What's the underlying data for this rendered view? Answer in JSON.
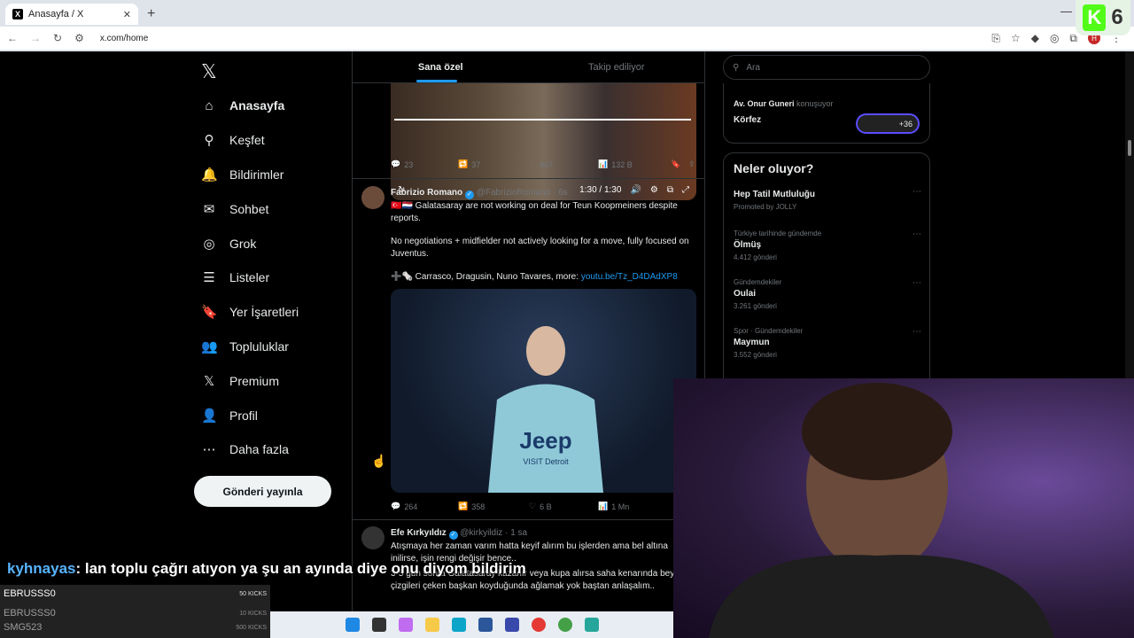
{
  "browser": {
    "tab_title": "Anasayfa / X",
    "tab_close": "✕",
    "new_tab": "+",
    "url": "x.com/home",
    "profile_initial": "H",
    "overlay_number": "6",
    "overlay_letter": "K"
  },
  "sidebar": {
    "logo": "𝕏",
    "items": [
      {
        "label": "Anasayfa",
        "icon": "home-icon",
        "glyph": "⌂"
      },
      {
        "label": "Keşfet",
        "icon": "search-icon",
        "glyph": "⚲"
      },
      {
        "label": "Bildirimler",
        "icon": "bell-icon",
        "glyph": "🔔"
      },
      {
        "label": "Sohbet",
        "icon": "mail-icon",
        "glyph": "✉"
      },
      {
        "label": "Grok",
        "icon": "grok-icon",
        "glyph": "◎"
      },
      {
        "label": "Listeler",
        "icon": "list-icon",
        "glyph": "☰"
      },
      {
        "label": "Yer İşaretleri",
        "icon": "bookmark-icon",
        "glyph": "🔖"
      },
      {
        "label": "Topluluklar",
        "icon": "community-icon",
        "glyph": "👥"
      },
      {
        "label": "Premium",
        "icon": "x-premium-icon",
        "glyph": "𝕏"
      },
      {
        "label": "Profil",
        "icon": "profile-icon",
        "glyph": "👤"
      },
      {
        "label": "Daha fazla",
        "icon": "more-icon",
        "glyph": "⋯"
      }
    ],
    "post_button": "Gönderi yayınla"
  },
  "feed": {
    "tabs": [
      "Sana özel",
      "Takip ediliyor"
    ],
    "video": {
      "time": "1:30 / 1:30"
    },
    "tweet1_actions": {
      "replies": "23",
      "reposts": "37",
      "likes": "867",
      "views": "132 B"
    },
    "tweet2": {
      "name": "Fabrizio Romano",
      "handle": "@FabrizioRomano",
      "time": "· 6s",
      "line1": "🇹🇷🇳🇱 Galatasaray are not working on deal for Teun Koopmeiners despite reports.",
      "line2": "No negotiations + midfielder not actively looking for a move, fully focused on Juventus.",
      "line3": "➕🗞️ Carrasco, Dragusin, Nuno Tavares, more:",
      "link": "youtu.be/Tz_D4DAdXP8",
      "photo_text": "Jeep",
      "photo_subtext": "VISIT Detroit",
      "actions": {
        "replies": "264",
        "reposts": "358",
        "likes": "6 B",
        "views": "1 Mn"
      }
    },
    "tweet3": {
      "name": "Efe Kırkyıldız",
      "handle": "@kirkyildiz",
      "time": "· 1 sa",
      "line1": "Atışmaya her zaman varım hatta keyif alırım bu işlerden ama bel altına inilirse, işin rengi değişir bence..",
      "line2": "3-5 gün sonra Galatasaray kazanır veya kupa alırsa saha kenarında bey çizgileri çeken başkan koyduğunda ağlamak yok baştan anlaşalım.."
    }
  },
  "right": {
    "search_placeholder": "Ara",
    "space": {
      "host": "Av. Onur Guneri",
      "speaking": "konuşuyor",
      "title": "Körfez",
      "count": "+36"
    },
    "trends_title": "Neler oluyor?",
    "trends": [
      {
        "context": "",
        "title": "Hep Tatil Mutluluğu",
        "count": "Promoted by JOLLY"
      },
      {
        "context": "Türkiye tarihinde gündemde",
        "title": "Ölmüş",
        "count": "4.412 gönderi"
      },
      {
        "context": "Gündemdekiler",
        "title": "Oulai",
        "count": "3.261 gönderi"
      },
      {
        "context": "Spor · Gündemdekiler",
        "title": "Maymun",
        "count": "3.552 gönderi"
      }
    ]
  },
  "stream": {
    "chat_user": "kyhnayas",
    "chat_text": ": lan toplu çağrı atıyon ya şu an ayında diye onu diyom bildirim",
    "kicks": [
      {
        "user": "EBRUSSS0",
        "amount": "50 KICKS"
      },
      {
        "user": "EBRUSSS0",
        "amount": "10 KICKS"
      },
      {
        "user": "SMG523",
        "amount": "500 KICKS"
      }
    ]
  },
  "colors": {
    "accent": "#1d9bf0",
    "bg": "#000000",
    "border": "#2f3336",
    "kick_green": "#53fc18"
  }
}
